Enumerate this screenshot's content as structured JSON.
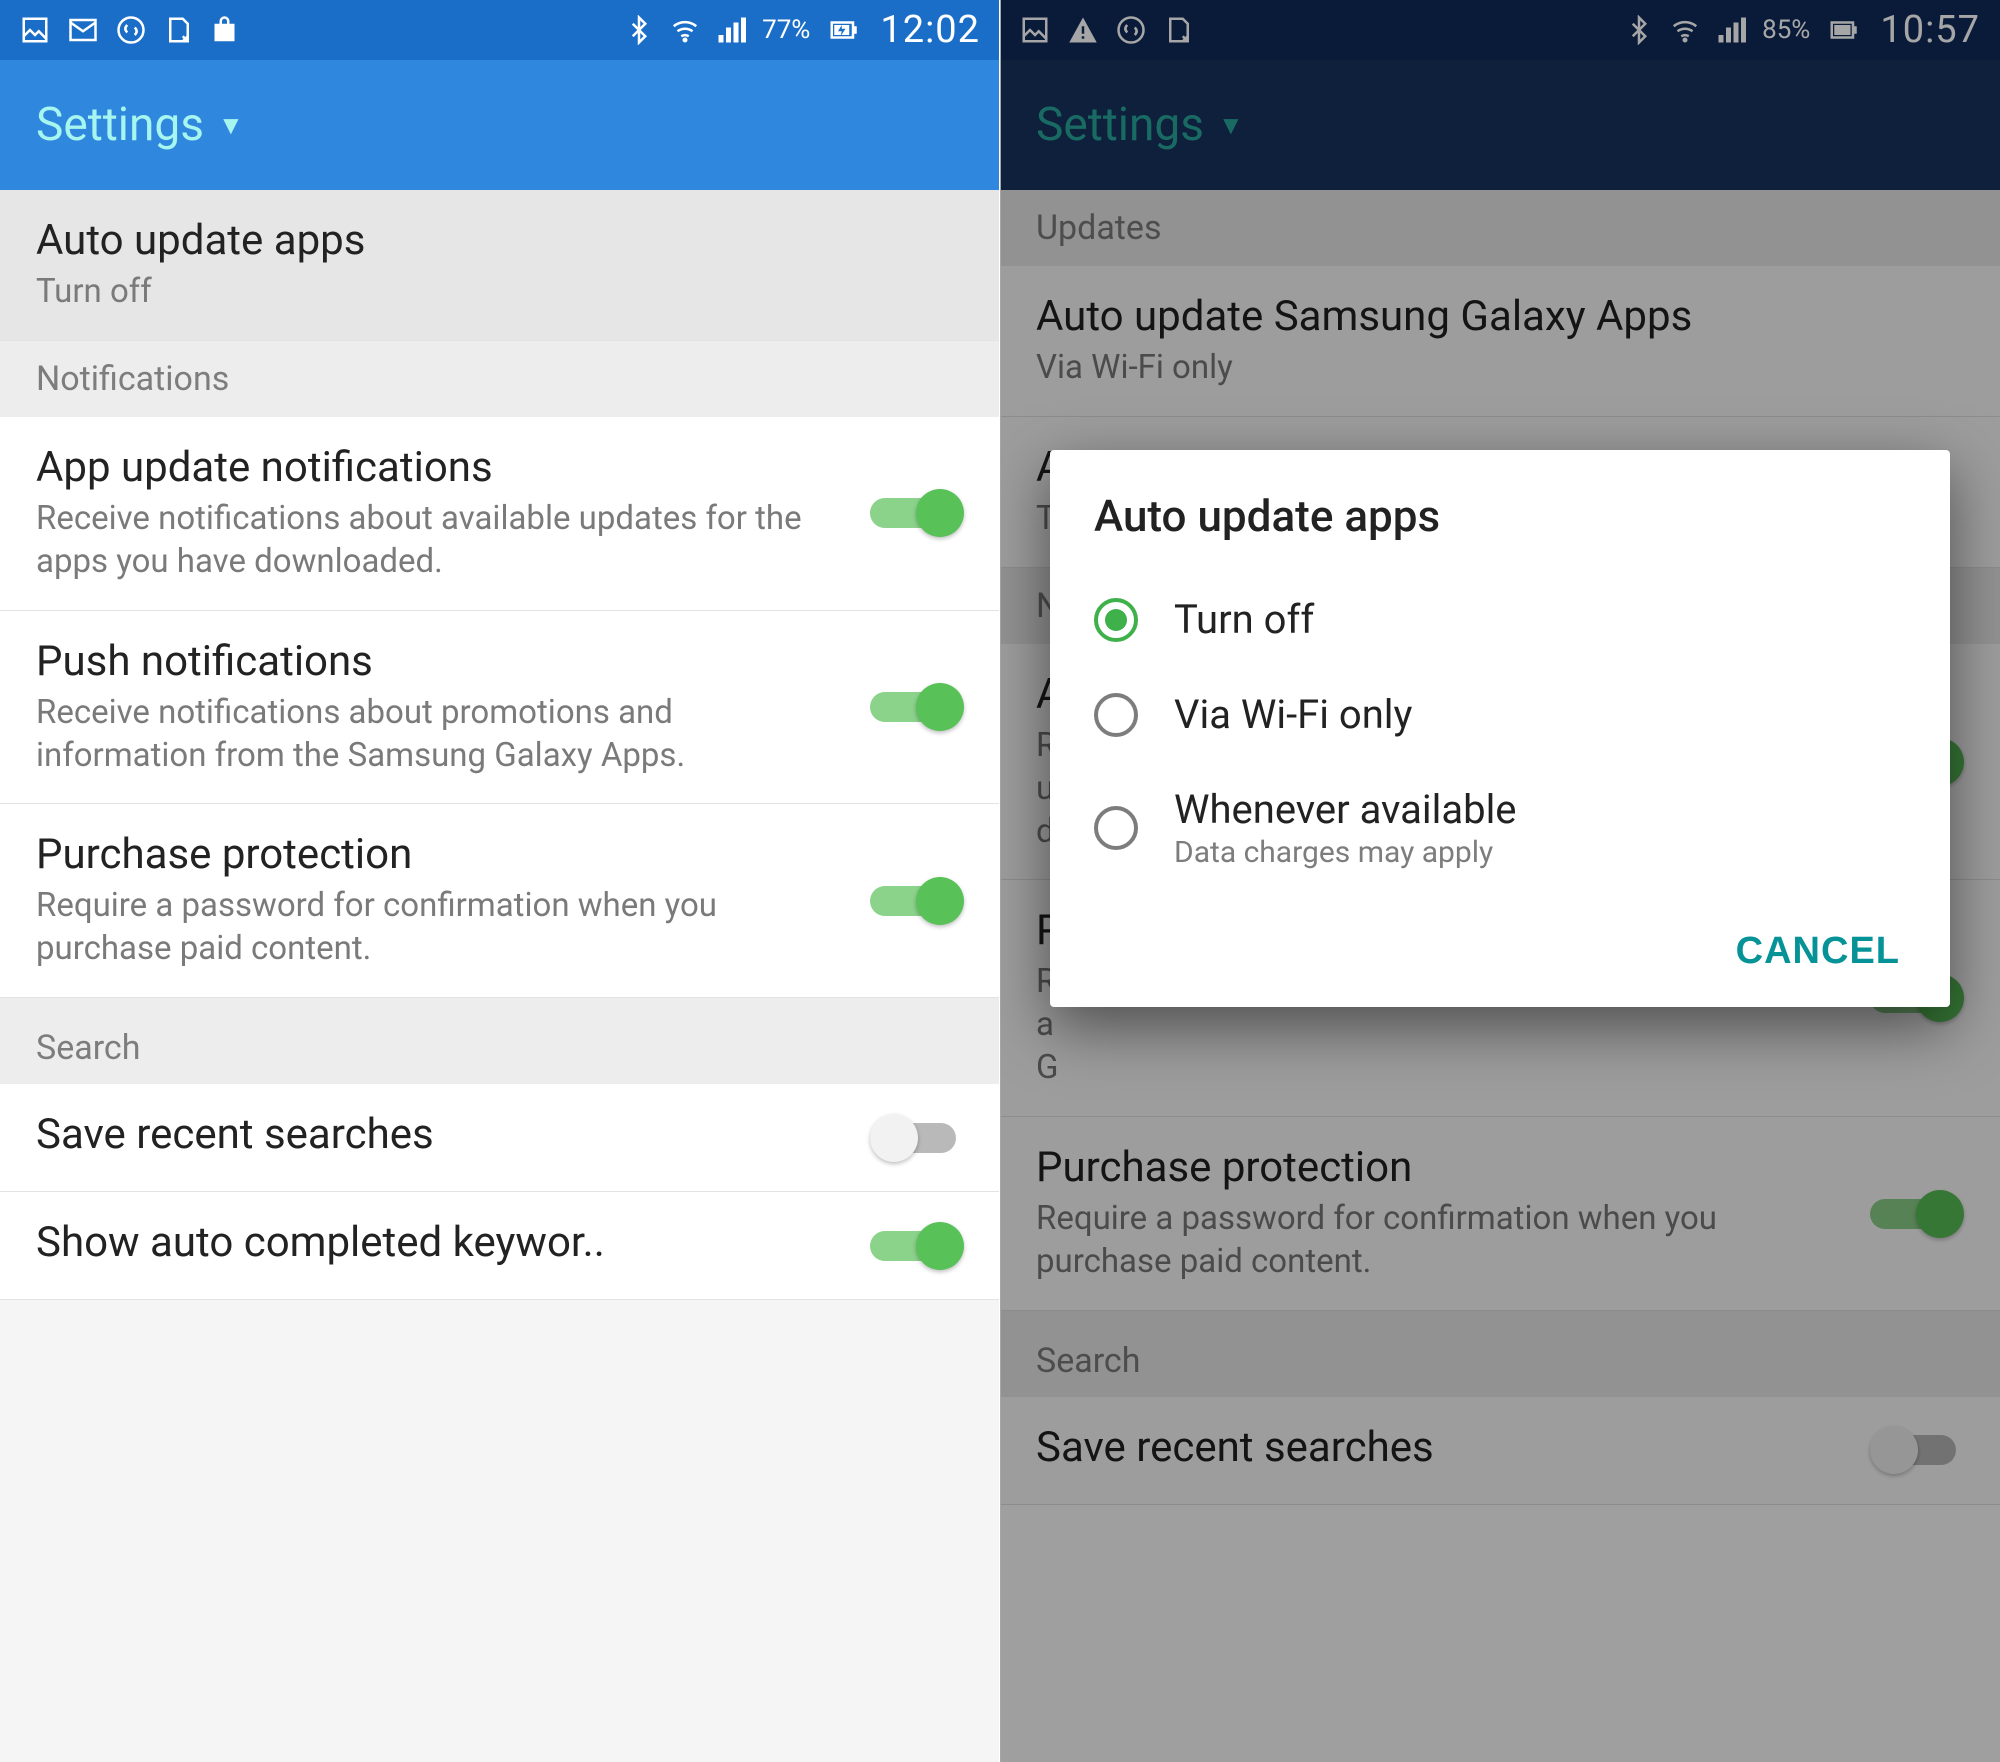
{
  "left": {
    "status": {
      "battery": "77%",
      "time": "12:02"
    },
    "app_bar": {
      "title": "Settings"
    },
    "auto_update": {
      "title": "Auto update apps",
      "sub": "Turn off"
    },
    "sections": {
      "notifications": "Notifications",
      "search": "Search"
    },
    "items": {
      "app_update_notifs": {
        "title": "App update notifications",
        "sub": "Receive notifications about available updates for the apps you have downloaded."
      },
      "push_notifs": {
        "title": "Push notifications",
        "sub": "Receive notifications about promotions and information from the Samsung Galaxy Apps."
      },
      "purchase_protection": {
        "title": "Purchase protection",
        "sub": "Require a password for confirmation when you purchase paid content."
      },
      "save_recent": {
        "title": "Save recent searches"
      },
      "show_auto": {
        "title": "Show auto completed keywor.."
      }
    }
  },
  "right": {
    "status": {
      "battery": "85%",
      "time": "10:57"
    },
    "app_bar": {
      "title": "Settings"
    },
    "sections": {
      "updates": "Updates",
      "notifications_short": "N",
      "search": "Search"
    },
    "items": {
      "auto_update_samsung": {
        "title": "Auto update Samsung Galaxy Apps",
        "sub": "Via Wi-Fi only"
      },
      "a1": {
        "title": "A",
        "sub": "T"
      },
      "a2": {
        "title": "A",
        "sub_lines": [
          "R",
          "u",
          "d"
        ]
      },
      "p": {
        "title": "P",
        "sub_lines": [
          "R",
          "a",
          "G"
        ]
      },
      "purchase_protection": {
        "title": "Purchase protection",
        "sub": "Require a password for confirmation when you purchase paid content."
      },
      "save_recent": {
        "title": "Save recent searches"
      }
    },
    "dialog": {
      "title": "Auto update apps",
      "options": [
        {
          "label": "Turn off",
          "selected": true
        },
        {
          "label": "Via Wi-Fi only",
          "selected": false
        },
        {
          "label": "Whenever available",
          "sub": "Data charges may apply",
          "selected": false
        }
      ],
      "cancel": "CANCEL"
    }
  }
}
